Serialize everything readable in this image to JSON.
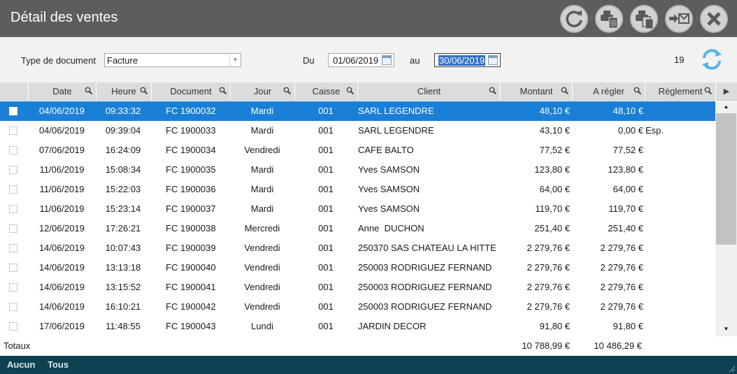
{
  "window": {
    "title": "Détail des ventes"
  },
  "toolbar": {
    "buttons": [
      {
        "name": "refresh-icon"
      },
      {
        "name": "print-document-icon"
      },
      {
        "name": "print-copy-icon"
      },
      {
        "name": "send-mail-icon"
      },
      {
        "name": "close-icon"
      }
    ]
  },
  "filters": {
    "doc_type_label": "Type de document",
    "doc_type_value": "Facture",
    "from_label": "Du",
    "from_value": "01/06/2019",
    "to_label": "au",
    "to_value": "30/06/2019",
    "count": "19"
  },
  "columns": [
    "Date",
    "Heure",
    "Document",
    "Jour",
    "Caisse",
    "Client",
    "Montant",
    "A régler",
    "Règlement"
  ],
  "rows": [
    {
      "date": "04/06/2019",
      "hour": "09:33:32",
      "doc": "FC 1900032",
      "day": "Mardi",
      "till": "001",
      "client": "SARL LEGENDRE",
      "amount": "48,10 €",
      "due": "48,10 €",
      "payment": ""
    },
    {
      "date": "04/06/2019",
      "hour": "09:39:04",
      "doc": "FC 1900033",
      "day": "Mardi",
      "till": "001",
      "client": "SARL LEGENDRE",
      "amount": "43,10 €",
      "due": "0,00 €",
      "payment": "Esp."
    },
    {
      "date": "07/06/2019",
      "hour": "16:24:09",
      "doc": "FC 1900034",
      "day": "Vendredi",
      "till": "001",
      "client": "CAFE BALTO",
      "amount": "77,52 €",
      "due": "77,52 €",
      "payment": ""
    },
    {
      "date": "11/06/2019",
      "hour": "15:08:34",
      "doc": "FC 1900035",
      "day": "Mardi",
      "till": "001",
      "client": "Yves SAMSON",
      "amount": "123,80 €",
      "due": "123,80 €",
      "payment": ""
    },
    {
      "date": "11/06/2019",
      "hour": "15:22:03",
      "doc": "FC 1900036",
      "day": "Mardi",
      "till": "001",
      "client": "Yves SAMSON",
      "amount": "64,00 €",
      "due": "64,00 €",
      "payment": ""
    },
    {
      "date": "11/06/2019",
      "hour": "15:23:14",
      "doc": "FC 1900037",
      "day": "Mardi",
      "till": "001",
      "client": "Yves SAMSON",
      "amount": "119,70 €",
      "due": "119,70 €",
      "payment": ""
    },
    {
      "date": "12/06/2019",
      "hour": "17:26:21",
      "doc": "FC 1900038",
      "day": "Mercredi",
      "till": "001",
      "client": "Anne  DUCHON",
      "amount": "251,40 €",
      "due": "251,40 €",
      "payment": ""
    },
    {
      "date": "14/06/2019",
      "hour": "10:07:43",
      "doc": "FC 1900039",
      "day": "Vendredi",
      "till": "001",
      "client": "250370 SAS CHATEAU LA HITTE",
      "amount": "2 279,76 €",
      "due": "2 279,76 €",
      "payment": ""
    },
    {
      "date": "14/06/2019",
      "hour": "13:13:18",
      "doc": "FC 1900040",
      "day": "Vendredi",
      "till": "001",
      "client": "250003 RODRIGUEZ FERNAND",
      "amount": "2 279,76 €",
      "due": "2 279,76 €",
      "payment": ""
    },
    {
      "date": "14/06/2019",
      "hour": "13:15:52",
      "doc": "FC 1900041",
      "day": "Vendredi",
      "till": "001",
      "client": "250003 RODRIGUEZ FERNAND",
      "amount": "2 279,76 €",
      "due": "2 279,76 €",
      "payment": ""
    },
    {
      "date": "14/06/2019",
      "hour": "16:10:21",
      "doc": "FC 1900042",
      "day": "Vendredi",
      "till": "001",
      "client": "250003 RODRIGUEZ FERNAND",
      "amount": "2 279,76 €",
      "due": "2 279,76 €",
      "payment": ""
    },
    {
      "date": "17/06/2019",
      "hour": "11:48:55",
      "doc": "FC 1900043",
      "day": "Lundi",
      "till": "001",
      "client": "JARDIN DECOR",
      "amount": "91,80 €",
      "due": "91,80 €",
      "payment": ""
    }
  ],
  "totals": {
    "label": "Totaux",
    "amount": "10 788,99 €",
    "due": "10 486,29 €"
  },
  "footer": {
    "none_label": "Aucun",
    "all_label": "Tous"
  },
  "colors": {
    "titlebar": "#5d5d5d",
    "selection": "#1a7fd6",
    "footer": "#0e4152"
  }
}
